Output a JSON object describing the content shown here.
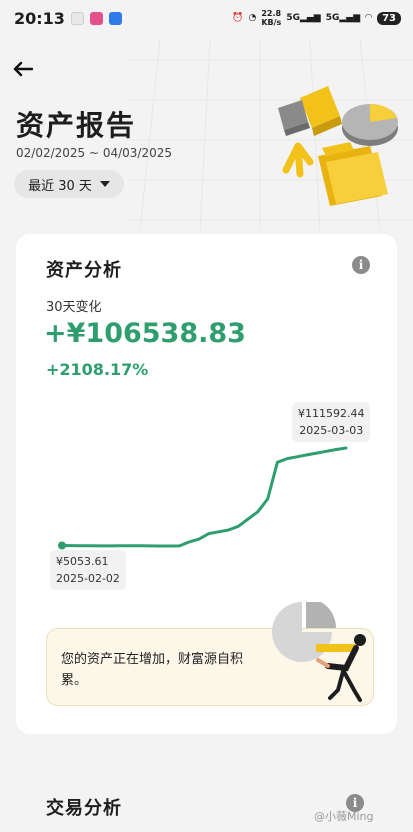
{
  "status_bar": {
    "time": "20:13",
    "net_speed_top": "22.8",
    "net_speed_bottom": "KB/s",
    "signal1": "5G",
    "signal2": "5G",
    "battery": "73"
  },
  "header": {
    "title": "资产报告",
    "date_range": "02/02/2025 ~ 04/03/2025",
    "period_selector": "最近 30 天"
  },
  "analysis": {
    "section_title": "资产分析",
    "change_label": "30天变化",
    "change_amount": "+¥106538.83",
    "change_percent": "+2108.17%",
    "end_tag": {
      "value": "¥111592.44",
      "date": "2025-03-03"
    },
    "start_tag": {
      "value": "¥5053.61",
      "date": "2025-02-02"
    },
    "message": "您的资产正在增加，财富源自积累。"
  },
  "trade": {
    "section_title": "交易分析"
  },
  "watermark": "@小薇Ming",
  "colors": {
    "accent_green": "#2e9e6e",
    "hero_yellow": "#f2c21b"
  },
  "chart_data": {
    "type": "line",
    "series": [
      {
        "values": [
          5053.61,
          4900,
          4800,
          4700,
          4650,
          4600,
          4700,
          4800,
          4850,
          4600,
          4500,
          4550,
          4600,
          9000,
          12000,
          18000,
          20000,
          22000,
          26000,
          34000,
          42000,
          56000,
          96000,
          100000,
          102000,
          104000,
          106000,
          108000,
          110000,
          111592.44
        ]
      }
    ],
    "x_start": "2025-02-02",
    "x_end": "2025-03-03",
    "grid": false,
    "axes_visible": false
  }
}
